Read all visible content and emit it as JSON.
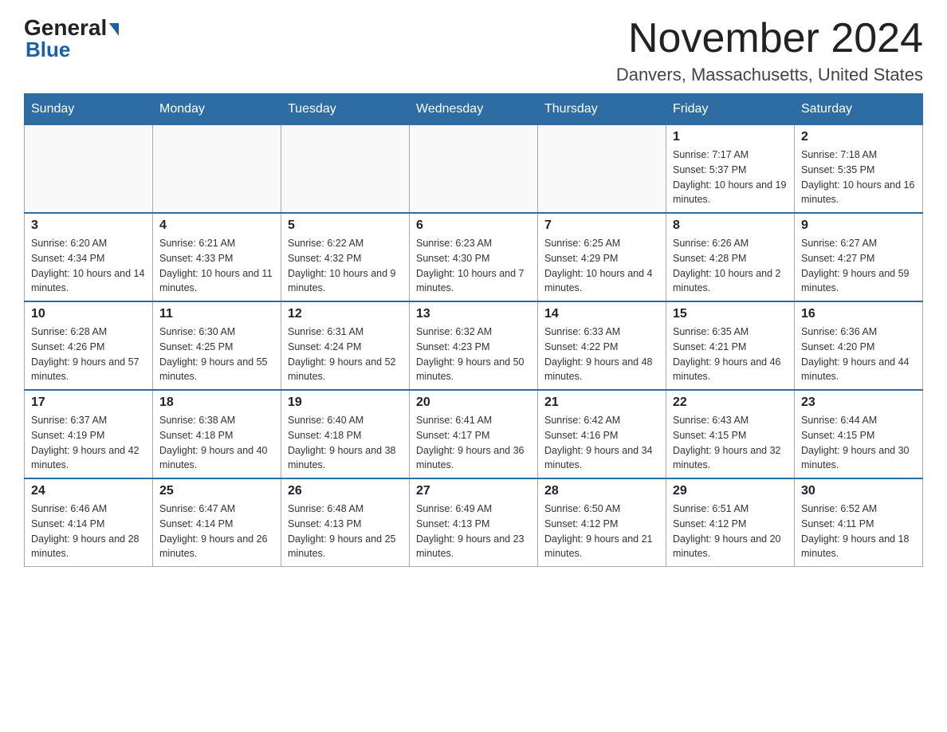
{
  "header": {
    "logo_line1": "General",
    "logo_line2": "Blue",
    "title": "November 2024",
    "subtitle": "Danvers, Massachusetts, United States"
  },
  "weekdays": [
    "Sunday",
    "Monday",
    "Tuesday",
    "Wednesday",
    "Thursday",
    "Friday",
    "Saturday"
  ],
  "weeks": [
    [
      {
        "day": "",
        "sunrise": "",
        "sunset": "",
        "daylight": ""
      },
      {
        "day": "",
        "sunrise": "",
        "sunset": "",
        "daylight": ""
      },
      {
        "day": "",
        "sunrise": "",
        "sunset": "",
        "daylight": ""
      },
      {
        "day": "",
        "sunrise": "",
        "sunset": "",
        "daylight": ""
      },
      {
        "day": "",
        "sunrise": "",
        "sunset": "",
        "daylight": ""
      },
      {
        "day": "1",
        "sunrise": "Sunrise: 7:17 AM",
        "sunset": "Sunset: 5:37 PM",
        "daylight": "Daylight: 10 hours and 19 minutes."
      },
      {
        "day": "2",
        "sunrise": "Sunrise: 7:18 AM",
        "sunset": "Sunset: 5:35 PM",
        "daylight": "Daylight: 10 hours and 16 minutes."
      }
    ],
    [
      {
        "day": "3",
        "sunrise": "Sunrise: 6:20 AM",
        "sunset": "Sunset: 4:34 PM",
        "daylight": "Daylight: 10 hours and 14 minutes."
      },
      {
        "day": "4",
        "sunrise": "Sunrise: 6:21 AM",
        "sunset": "Sunset: 4:33 PM",
        "daylight": "Daylight: 10 hours and 11 minutes."
      },
      {
        "day": "5",
        "sunrise": "Sunrise: 6:22 AM",
        "sunset": "Sunset: 4:32 PM",
        "daylight": "Daylight: 10 hours and 9 minutes."
      },
      {
        "day": "6",
        "sunrise": "Sunrise: 6:23 AM",
        "sunset": "Sunset: 4:30 PM",
        "daylight": "Daylight: 10 hours and 7 minutes."
      },
      {
        "day": "7",
        "sunrise": "Sunrise: 6:25 AM",
        "sunset": "Sunset: 4:29 PM",
        "daylight": "Daylight: 10 hours and 4 minutes."
      },
      {
        "day": "8",
        "sunrise": "Sunrise: 6:26 AM",
        "sunset": "Sunset: 4:28 PM",
        "daylight": "Daylight: 10 hours and 2 minutes."
      },
      {
        "day": "9",
        "sunrise": "Sunrise: 6:27 AM",
        "sunset": "Sunset: 4:27 PM",
        "daylight": "Daylight: 9 hours and 59 minutes."
      }
    ],
    [
      {
        "day": "10",
        "sunrise": "Sunrise: 6:28 AM",
        "sunset": "Sunset: 4:26 PM",
        "daylight": "Daylight: 9 hours and 57 minutes."
      },
      {
        "day": "11",
        "sunrise": "Sunrise: 6:30 AM",
        "sunset": "Sunset: 4:25 PM",
        "daylight": "Daylight: 9 hours and 55 minutes."
      },
      {
        "day": "12",
        "sunrise": "Sunrise: 6:31 AM",
        "sunset": "Sunset: 4:24 PM",
        "daylight": "Daylight: 9 hours and 52 minutes."
      },
      {
        "day": "13",
        "sunrise": "Sunrise: 6:32 AM",
        "sunset": "Sunset: 4:23 PM",
        "daylight": "Daylight: 9 hours and 50 minutes."
      },
      {
        "day": "14",
        "sunrise": "Sunrise: 6:33 AM",
        "sunset": "Sunset: 4:22 PM",
        "daylight": "Daylight: 9 hours and 48 minutes."
      },
      {
        "day": "15",
        "sunrise": "Sunrise: 6:35 AM",
        "sunset": "Sunset: 4:21 PM",
        "daylight": "Daylight: 9 hours and 46 minutes."
      },
      {
        "day": "16",
        "sunrise": "Sunrise: 6:36 AM",
        "sunset": "Sunset: 4:20 PM",
        "daylight": "Daylight: 9 hours and 44 minutes."
      }
    ],
    [
      {
        "day": "17",
        "sunrise": "Sunrise: 6:37 AM",
        "sunset": "Sunset: 4:19 PM",
        "daylight": "Daylight: 9 hours and 42 minutes."
      },
      {
        "day": "18",
        "sunrise": "Sunrise: 6:38 AM",
        "sunset": "Sunset: 4:18 PM",
        "daylight": "Daylight: 9 hours and 40 minutes."
      },
      {
        "day": "19",
        "sunrise": "Sunrise: 6:40 AM",
        "sunset": "Sunset: 4:18 PM",
        "daylight": "Daylight: 9 hours and 38 minutes."
      },
      {
        "day": "20",
        "sunrise": "Sunrise: 6:41 AM",
        "sunset": "Sunset: 4:17 PM",
        "daylight": "Daylight: 9 hours and 36 minutes."
      },
      {
        "day": "21",
        "sunrise": "Sunrise: 6:42 AM",
        "sunset": "Sunset: 4:16 PM",
        "daylight": "Daylight: 9 hours and 34 minutes."
      },
      {
        "day": "22",
        "sunrise": "Sunrise: 6:43 AM",
        "sunset": "Sunset: 4:15 PM",
        "daylight": "Daylight: 9 hours and 32 minutes."
      },
      {
        "day": "23",
        "sunrise": "Sunrise: 6:44 AM",
        "sunset": "Sunset: 4:15 PM",
        "daylight": "Daylight: 9 hours and 30 minutes."
      }
    ],
    [
      {
        "day": "24",
        "sunrise": "Sunrise: 6:46 AM",
        "sunset": "Sunset: 4:14 PM",
        "daylight": "Daylight: 9 hours and 28 minutes."
      },
      {
        "day": "25",
        "sunrise": "Sunrise: 6:47 AM",
        "sunset": "Sunset: 4:14 PM",
        "daylight": "Daylight: 9 hours and 26 minutes."
      },
      {
        "day": "26",
        "sunrise": "Sunrise: 6:48 AM",
        "sunset": "Sunset: 4:13 PM",
        "daylight": "Daylight: 9 hours and 25 minutes."
      },
      {
        "day": "27",
        "sunrise": "Sunrise: 6:49 AM",
        "sunset": "Sunset: 4:13 PM",
        "daylight": "Daylight: 9 hours and 23 minutes."
      },
      {
        "day": "28",
        "sunrise": "Sunrise: 6:50 AM",
        "sunset": "Sunset: 4:12 PM",
        "daylight": "Daylight: 9 hours and 21 minutes."
      },
      {
        "day": "29",
        "sunrise": "Sunrise: 6:51 AM",
        "sunset": "Sunset: 4:12 PM",
        "daylight": "Daylight: 9 hours and 20 minutes."
      },
      {
        "day": "30",
        "sunrise": "Sunrise: 6:52 AM",
        "sunset": "Sunset: 4:11 PM",
        "daylight": "Daylight: 9 hours and 18 minutes."
      }
    ]
  ]
}
